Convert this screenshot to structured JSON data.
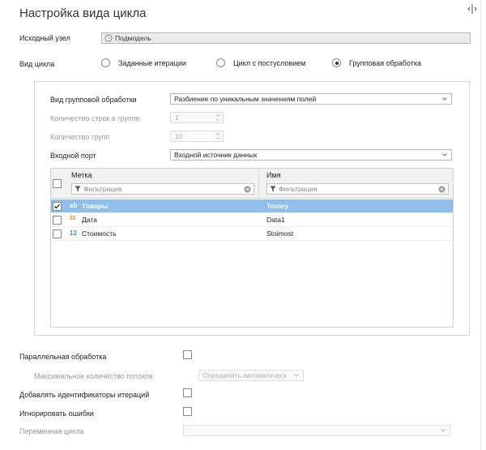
{
  "header": {
    "title": "Настройка вида цикла",
    "corner_icon": "split-view-icon"
  },
  "source_node": {
    "label": "Исходный узел",
    "value": "Подмодель",
    "icon": "node-icon"
  },
  "cycle_type": {
    "label": "Вид цикла",
    "options": [
      {
        "label": "Заданные итерации",
        "selected": false
      },
      {
        "label": "Цикл с постусловием",
        "selected": false
      },
      {
        "label": "Групповая обработка",
        "selected": true
      }
    ]
  },
  "group": {
    "type_label": "Вид групповой обработки",
    "type_value": "Разбиение по уникальным значениям полей",
    "rows_label": "Количество строк в группе",
    "rows_value": "1",
    "groups_label": "Количество групп",
    "groups_value": "10",
    "port_label": "Входной порт",
    "port_value": "Входной источник данных"
  },
  "fields_table": {
    "columns": [
      "Метка",
      "Имя"
    ],
    "filter_placeholder": "Фильтрация",
    "rows": [
      {
        "type": "ab",
        "type_color": "#3a8fd8",
        "label": "Товары",
        "name": "Tovary",
        "checked": true
      },
      {
        "type": "31",
        "type_color": "#e08a2a",
        "label": "Дата",
        "name": "Data1",
        "checked": false
      },
      {
        "type": "12",
        "type_color": "#3a8fd8",
        "label": "Стоимость",
        "name": "Stoimost",
        "checked": false
      }
    ]
  },
  "options": {
    "parallel_label": "Параллельная обработка",
    "max_threads_label": "Максимальное количество потоков",
    "max_threads_value": "Определять автоматическ",
    "add_ids_label": "Добавлять идентификаторы итераций",
    "ignore_errors_label": "Игнорировать ошибки",
    "cycle_var_label": "Переменная цикла",
    "cycle_var_value": ""
  },
  "colors": {
    "selected_row": "#8fbfea",
    "accent": "#3a8fd8"
  }
}
